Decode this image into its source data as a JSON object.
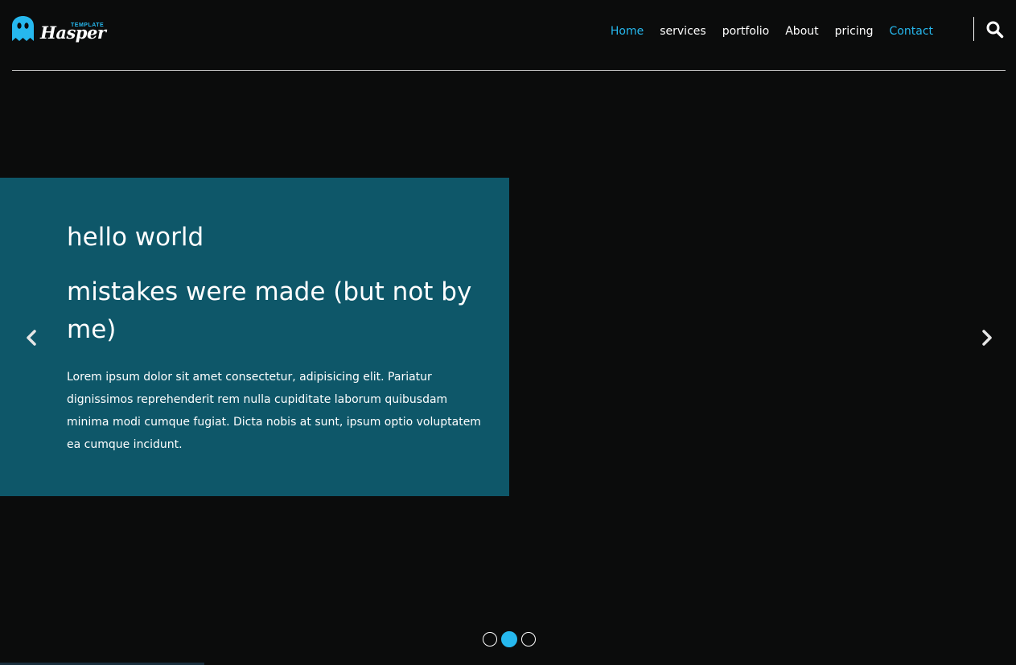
{
  "logo": {
    "tag": "TEMPLATE",
    "wordmark": "Hasper"
  },
  "nav": {
    "items": [
      {
        "label": "Home",
        "active": true
      },
      {
        "label": "services",
        "active": false
      },
      {
        "label": "portfolio",
        "active": false
      },
      {
        "label": "About",
        "active": false
      },
      {
        "label": "pricing",
        "active": false
      },
      {
        "label": "Contact",
        "active": true
      }
    ]
  },
  "slide": {
    "title": "hello world",
    "subtitle": "mistakes were made (but not by me)",
    "body": "Lorem ipsum dolor sit amet consectetur, adipisicing elit. Pariatur dignissimos reprehenderit rem nulla cupiditate laborum quibusdam minima modi cumque fugiat. Dicta nobis at sunt, ipsum optio voluptatem ea cumque incidunt."
  },
  "slider": {
    "total_slides": 3,
    "active_slide": 2
  },
  "colors": {
    "accent": "#26b8ee",
    "background": "#0b0c0c",
    "slide_box": "#0e5769",
    "text": "#ffffff"
  },
  "icons": {
    "logo": "ghost-icon",
    "search": "search-icon",
    "prev": "chevron-left-icon",
    "next": "chevron-right-icon"
  }
}
